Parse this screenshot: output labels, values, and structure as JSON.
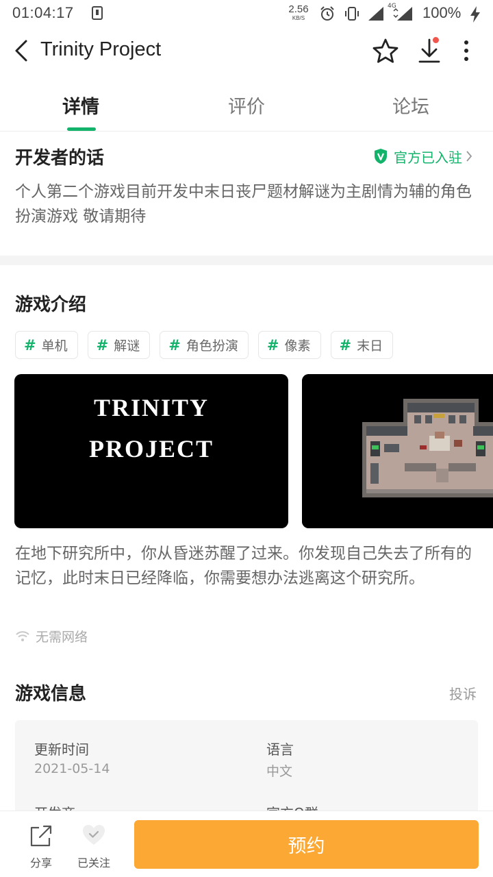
{
  "status_bar": {
    "time": "01:04:17",
    "net_speed_value": "2.56",
    "net_speed_unit": "KB/S",
    "network_type": "4G",
    "battery": "100%",
    "icons": [
      "download-notification-icon",
      "alarm-icon",
      "vibrate-icon",
      "signal-icon",
      "signal-4g-icon",
      "charging-icon"
    ]
  },
  "header": {
    "title": "Trinity Project",
    "icons": [
      "back-arrow-icon",
      "star-icon",
      "download-icon",
      "more-vertical-icon"
    ]
  },
  "tabs": [
    {
      "label": "详情",
      "active": true
    },
    {
      "label": "评价",
      "active": false
    },
    {
      "label": "论坛",
      "active": false
    }
  ],
  "developer": {
    "title": "开发者的话",
    "official_label": "官方已入驻",
    "text": "个人第二个游戏目前开发中末日丧尸题材解谜为主剧情为辅的角色扮演游戏 敬请期待"
  },
  "intro": {
    "title": "游戏介绍",
    "tags": [
      "单机",
      "解谜",
      "角色扮演",
      "像素",
      "末日"
    ],
    "screenshot_title_lines": [
      "TRINITY",
      "PROJECT"
    ],
    "description": "在地下研究所中，你从昏迷苏醒了过来。你发现自己失去了所有的记忆，此时末日已经降临，你需要想办法逃离这个研究所。",
    "network": "无需网络"
  },
  "info": {
    "title": "游戏信息",
    "complaint": "投诉",
    "fields": [
      {
        "label": "更新时间",
        "value": "2021-05-14"
      },
      {
        "label": "语言",
        "value": "中文"
      },
      {
        "label": "开发商",
        "value": ""
      },
      {
        "label": "官方Q群",
        "value": ""
      }
    ]
  },
  "bottom_bar": {
    "share_label": "分享",
    "follow_label": "已关注",
    "reserve_label": "预约"
  },
  "colors": {
    "accent_green": "#14b36b",
    "reserve_orange": "#fca834",
    "notification_dot": "#f0564d"
  }
}
